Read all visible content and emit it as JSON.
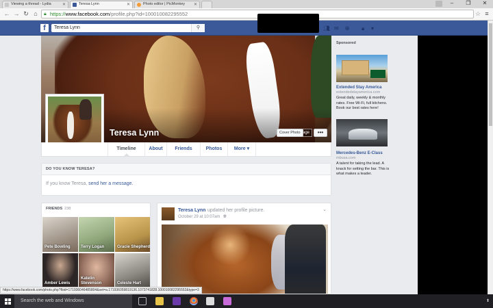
{
  "browser": {
    "tabs": [
      {
        "title": "Viewing a thread - Lydia",
        "active": false
      },
      {
        "title": "Teresa Lynn",
        "active": true
      },
      {
        "title": "Photo editor | PicMonkey",
        "active": false
      }
    ],
    "url_scheme": "https://",
    "url_host": "www.facebook.com",
    "url_path": "/profile.php?id=100010082295552"
  },
  "fb_header": {
    "logo": "f",
    "search_value": "Teresa Lynn"
  },
  "profile": {
    "name": "Teresa Lynn",
    "cover_photo_button": "Cover Photo",
    "update_label": "age",
    "more_dots": "•••",
    "nav_tabs": [
      "Timeline",
      "About",
      "Friends",
      "Photos",
      "More ▾"
    ]
  },
  "know_card": {
    "heading": "DO YOU KNOW TERESA?",
    "prefix": "If you know Teresa, ",
    "link": "send her a message."
  },
  "friends": {
    "heading": "FRIENDS",
    "count": "238",
    "items": [
      {
        "name": "Pete Bowling",
        "color": "#7a6a5a"
      },
      {
        "name": "Terry Logan",
        "color": "#8fa67a"
      },
      {
        "name": "Gracie Shepherd",
        "color": "#b8944a"
      },
      {
        "name": "Amber Lewis",
        "color": "#2d2626"
      },
      {
        "name": "Katelin Stevenson",
        "color": "#a07a6a"
      },
      {
        "name": "Celeste Hart",
        "color": "#8a8680"
      }
    ]
  },
  "post": {
    "author": "Teresa Lynn",
    "action": "updated her profile picture.",
    "time": "October 29 at 10:07am",
    "privacy_icon": "globe-icon"
  },
  "sponsored": {
    "heading": "Sponsored",
    "ads": [
      {
        "title": "Extended Stay America",
        "url": "extendedstayamerica.com",
        "text": "Great daily, weekly & monthly rates. Free Wi-Fi, full kitchens. Book our best rates here!"
      },
      {
        "title": "Mercedes-Benz E-Class",
        "url": "mbusa.com",
        "text": "A talent for taking the lead. A knack for setting the bar. This is what makes a leader."
      }
    ]
  },
  "status_url": "https://www.facebook.com/photo.php?fbid=171936046485804&set=a.171936059819136.1073741828.100010082295552&type=3",
  "taskbar": {
    "search_placeholder": "Search the web and Windows"
  }
}
